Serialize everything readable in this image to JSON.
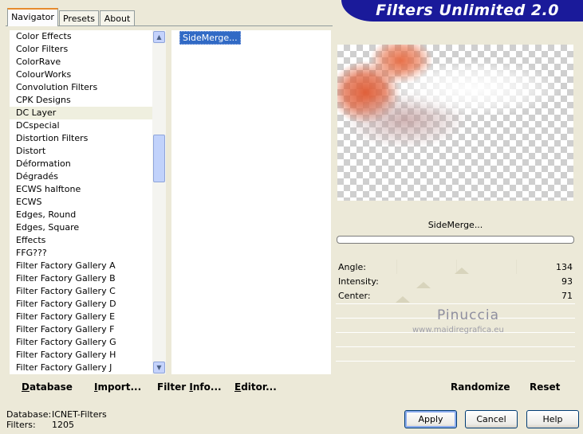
{
  "tabs": [
    "Navigator",
    "Presets",
    "About"
  ],
  "banner_title": "Filters Unlimited 2.0",
  "categories": [
    "Color Effects",
    "Color Filters",
    "ColorRave",
    "ColourWorks",
    "Convolution Filters",
    "CPK Designs",
    "DC Layer",
    "DCspecial",
    "Distortion Filters",
    "Distort",
    "Déformation",
    "Dégradés",
    "ECWS halftone",
    "ECWS",
    "Edges, Round",
    "Edges, Square",
    "Effects",
    "FFG???",
    "Filter Factory Gallery A",
    "Filter Factory Gallery B",
    "Filter Factory Gallery C",
    "Filter Factory Gallery D",
    "Filter Factory Gallery E",
    "Filter Factory Gallery F",
    "Filter Factory Gallery G",
    "Filter Factory Gallery H",
    "Filter Factory Gallery J"
  ],
  "selected_category": "DC Layer",
  "filters": [
    "SideMerge..."
  ],
  "selected_filter": "SideMerge...",
  "preview_filter_name": "SideMerge...",
  "params": [
    {
      "label": "Angle:",
      "value": "134"
    },
    {
      "label": "Intensity:",
      "value": "93"
    },
    {
      "label": "Center:",
      "value": "71"
    }
  ],
  "left_buttons": {
    "database": {
      "u": "D",
      "rest": "atabase"
    },
    "import": {
      "u": "I",
      "pre": "",
      "rest": "mport..."
    },
    "filter_info": {
      "pre": "Filter ",
      "u": "I",
      "rest": "nfo..."
    },
    "editor": {
      "u": "E",
      "rest": "ditor..."
    }
  },
  "right_buttons": {
    "randomize": "Randomize",
    "reset": "Reset"
  },
  "status": {
    "database_label": "Database:",
    "database_value": "ICNET-Filters",
    "filters_label": "Filters:",
    "filters_value": "1205"
  },
  "dialog_buttons": {
    "apply": "Apply",
    "cancel": "Cancel",
    "help": "Help"
  },
  "watermark": {
    "name": "Pinuccia",
    "url": "www.maidiregrafica.eu"
  },
  "icons": {
    "scroll_up": "chevron-up-icon",
    "scroll_down": "chevron-down-icon"
  },
  "colors": {
    "banner": "#1a1a9a",
    "selection": "#316ac5",
    "tab_accent": "#e68b2c"
  }
}
